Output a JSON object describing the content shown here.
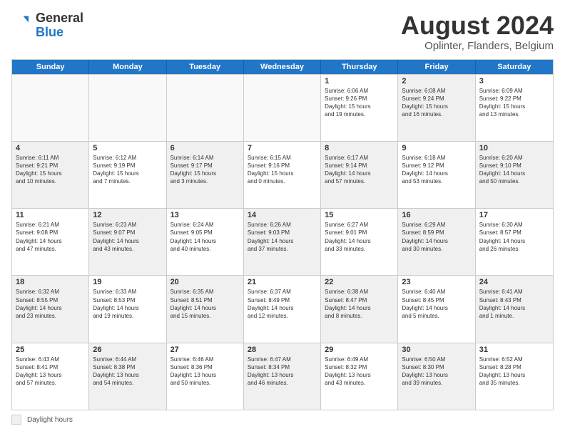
{
  "logo": {
    "general": "General",
    "blue": "Blue"
  },
  "header": {
    "month_year": "August 2024",
    "location": "Oplinter, Flanders, Belgium"
  },
  "days_of_week": [
    "Sunday",
    "Monday",
    "Tuesday",
    "Wednesday",
    "Thursday",
    "Friday",
    "Saturday"
  ],
  "legend": {
    "label": "Daylight hours"
  },
  "weeks": [
    [
      {
        "day": "",
        "text": "",
        "empty": true
      },
      {
        "day": "",
        "text": "",
        "empty": true
      },
      {
        "day": "",
        "text": "",
        "empty": true
      },
      {
        "day": "",
        "text": "",
        "empty": true
      },
      {
        "day": "1",
        "text": "Sunrise: 6:06 AM\nSunset: 9:26 PM\nDaylight: 15 hours\nand 19 minutes.",
        "shaded": false
      },
      {
        "day": "2",
        "text": "Sunrise: 6:08 AM\nSunset: 9:24 PM\nDaylight: 15 hours\nand 16 minutes.",
        "shaded": true
      },
      {
        "day": "3",
        "text": "Sunrise: 6:09 AM\nSunset: 9:22 PM\nDaylight: 15 hours\nand 13 minutes.",
        "shaded": false
      }
    ],
    [
      {
        "day": "4",
        "text": "Sunrise: 6:11 AM\nSunset: 9:21 PM\nDaylight: 15 hours\nand 10 minutes.",
        "shaded": true
      },
      {
        "day": "5",
        "text": "Sunrise: 6:12 AM\nSunset: 9:19 PM\nDaylight: 15 hours\nand 7 minutes.",
        "shaded": false
      },
      {
        "day": "6",
        "text": "Sunrise: 6:14 AM\nSunset: 9:17 PM\nDaylight: 15 hours\nand 3 minutes.",
        "shaded": true
      },
      {
        "day": "7",
        "text": "Sunrise: 6:15 AM\nSunset: 9:16 PM\nDaylight: 15 hours\nand 0 minutes.",
        "shaded": false
      },
      {
        "day": "8",
        "text": "Sunrise: 6:17 AM\nSunset: 9:14 PM\nDaylight: 14 hours\nand 57 minutes.",
        "shaded": true
      },
      {
        "day": "9",
        "text": "Sunrise: 6:18 AM\nSunset: 9:12 PM\nDaylight: 14 hours\nand 53 minutes.",
        "shaded": false
      },
      {
        "day": "10",
        "text": "Sunrise: 6:20 AM\nSunset: 9:10 PM\nDaylight: 14 hours\nand 50 minutes.",
        "shaded": true
      }
    ],
    [
      {
        "day": "11",
        "text": "Sunrise: 6:21 AM\nSunset: 9:08 PM\nDaylight: 14 hours\nand 47 minutes.",
        "shaded": false
      },
      {
        "day": "12",
        "text": "Sunrise: 6:23 AM\nSunset: 9:07 PM\nDaylight: 14 hours\nand 43 minutes.",
        "shaded": true
      },
      {
        "day": "13",
        "text": "Sunrise: 6:24 AM\nSunset: 9:05 PM\nDaylight: 14 hours\nand 40 minutes.",
        "shaded": false
      },
      {
        "day": "14",
        "text": "Sunrise: 6:26 AM\nSunset: 9:03 PM\nDaylight: 14 hours\nand 37 minutes.",
        "shaded": true
      },
      {
        "day": "15",
        "text": "Sunrise: 6:27 AM\nSunset: 9:01 PM\nDaylight: 14 hours\nand 33 minutes.",
        "shaded": false
      },
      {
        "day": "16",
        "text": "Sunrise: 6:29 AM\nSunset: 8:59 PM\nDaylight: 14 hours\nand 30 minutes.",
        "shaded": true
      },
      {
        "day": "17",
        "text": "Sunrise: 6:30 AM\nSunset: 8:57 PM\nDaylight: 14 hours\nand 26 minutes.",
        "shaded": false
      }
    ],
    [
      {
        "day": "18",
        "text": "Sunrise: 6:32 AM\nSunset: 8:55 PM\nDaylight: 14 hours\nand 23 minutes.",
        "shaded": true
      },
      {
        "day": "19",
        "text": "Sunrise: 6:33 AM\nSunset: 8:53 PM\nDaylight: 14 hours\nand 19 minutes.",
        "shaded": false
      },
      {
        "day": "20",
        "text": "Sunrise: 6:35 AM\nSunset: 8:51 PM\nDaylight: 14 hours\nand 15 minutes.",
        "shaded": true
      },
      {
        "day": "21",
        "text": "Sunrise: 6:37 AM\nSunset: 8:49 PM\nDaylight: 14 hours\nand 12 minutes.",
        "shaded": false
      },
      {
        "day": "22",
        "text": "Sunrise: 6:38 AM\nSunset: 8:47 PM\nDaylight: 14 hours\nand 8 minutes.",
        "shaded": true
      },
      {
        "day": "23",
        "text": "Sunrise: 6:40 AM\nSunset: 8:45 PM\nDaylight: 14 hours\nand 5 minutes.",
        "shaded": false
      },
      {
        "day": "24",
        "text": "Sunrise: 6:41 AM\nSunset: 8:43 PM\nDaylight: 14 hours\nand 1 minute.",
        "shaded": true
      }
    ],
    [
      {
        "day": "25",
        "text": "Sunrise: 6:43 AM\nSunset: 8:41 PM\nDaylight: 13 hours\nand 57 minutes.",
        "shaded": false
      },
      {
        "day": "26",
        "text": "Sunrise: 6:44 AM\nSunset: 8:38 PM\nDaylight: 13 hours\nand 54 minutes.",
        "shaded": true
      },
      {
        "day": "27",
        "text": "Sunrise: 6:46 AM\nSunset: 8:36 PM\nDaylight: 13 hours\nand 50 minutes.",
        "shaded": false
      },
      {
        "day": "28",
        "text": "Sunrise: 6:47 AM\nSunset: 8:34 PM\nDaylight: 13 hours\nand 46 minutes.",
        "shaded": true
      },
      {
        "day": "29",
        "text": "Sunrise: 6:49 AM\nSunset: 8:32 PM\nDaylight: 13 hours\nand 43 minutes.",
        "shaded": false
      },
      {
        "day": "30",
        "text": "Sunrise: 6:50 AM\nSunset: 8:30 PM\nDaylight: 13 hours\nand 39 minutes.",
        "shaded": true
      },
      {
        "day": "31",
        "text": "Sunrise: 6:52 AM\nSunset: 8:28 PM\nDaylight: 13 hours\nand 35 minutes.",
        "shaded": false
      }
    ]
  ]
}
